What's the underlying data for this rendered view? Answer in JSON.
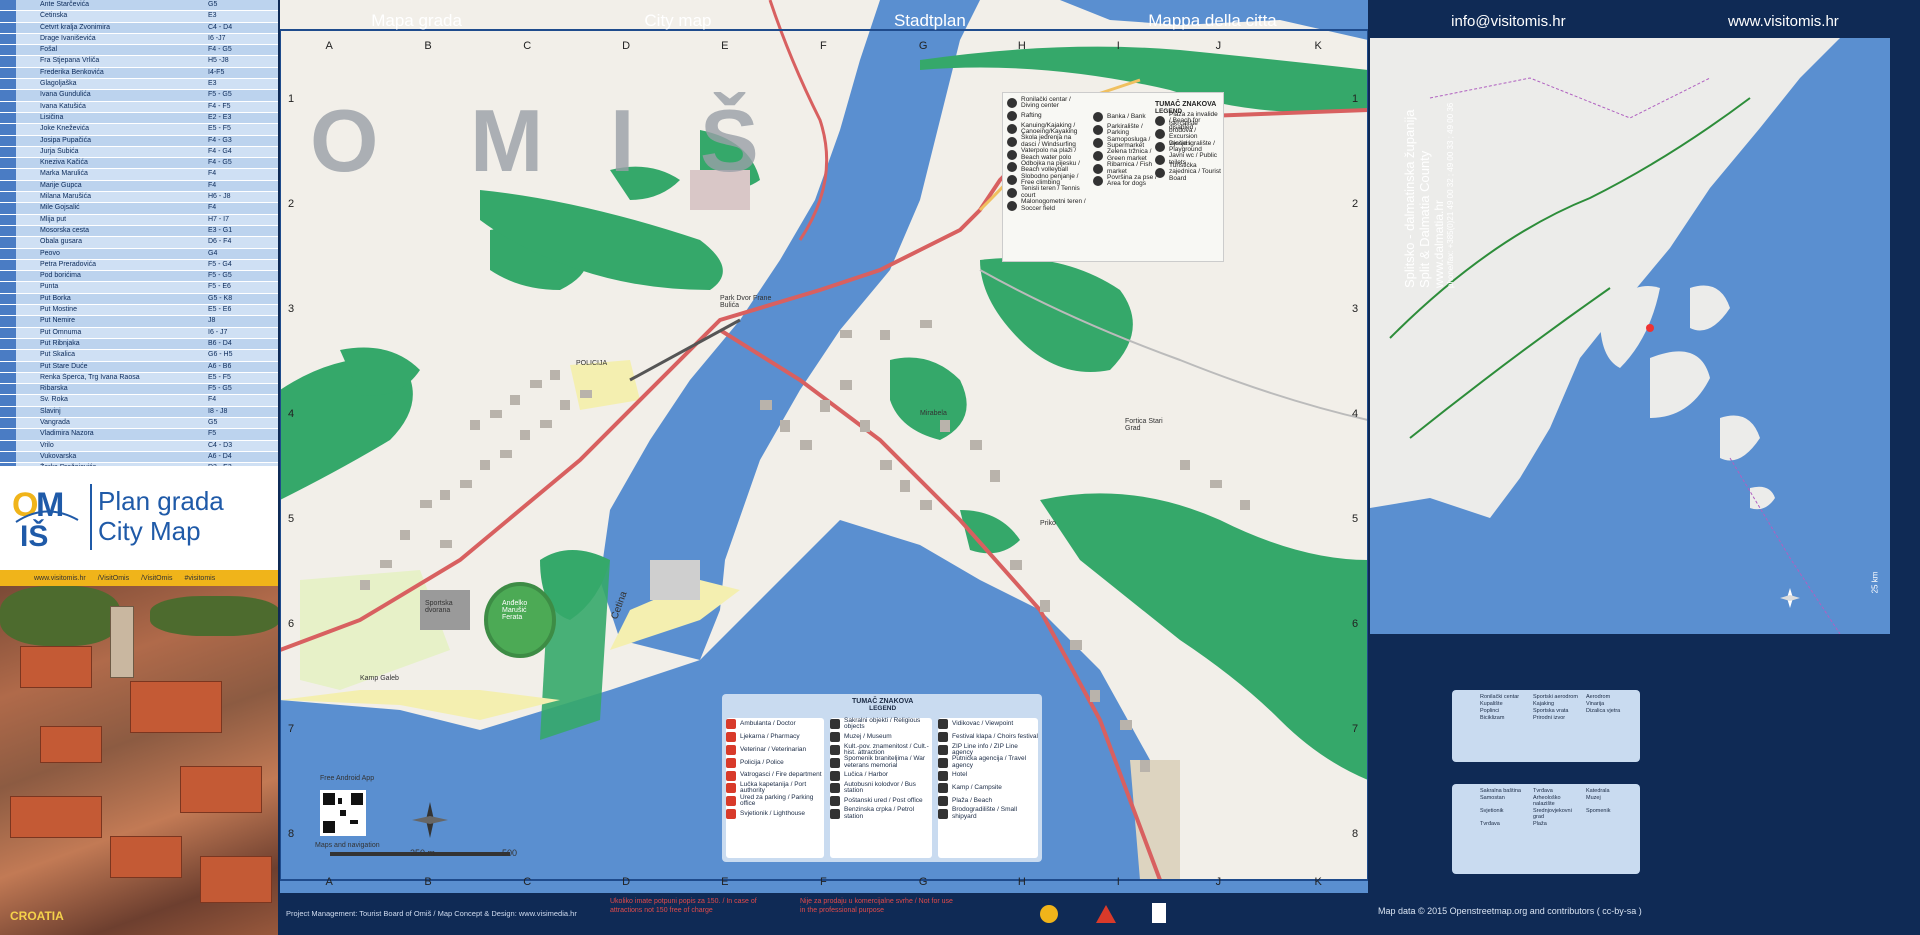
{
  "streets": [
    {
      "name": "Ante Starčevića",
      "grid": "G5"
    },
    {
      "name": "Četinska",
      "grid": "E3"
    },
    {
      "name": "Četvrt kralja Zvonimira",
      "grid": "C4 - D4"
    },
    {
      "name": "Drage Ivaniševića",
      "grid": "I6 -J7"
    },
    {
      "name": "Fošal",
      "grid": "F4 - G5"
    },
    {
      "name": "Fra Stjepana Vrliča",
      "grid": "H5 -J8"
    },
    {
      "name": "Frederika Benkovića",
      "grid": "I4-F5"
    },
    {
      "name": "Glagoljaška",
      "grid": "E3"
    },
    {
      "name": "Ivana Gundulića",
      "grid": "F5 - G5"
    },
    {
      "name": "Ivana Katušića",
      "grid": "F4 - F5"
    },
    {
      "name": "Lisičina",
      "grid": "E2 - E3"
    },
    {
      "name": "Joke Kneževića",
      "grid": "E5 - F5"
    },
    {
      "name": "Josipa Pupačića",
      "grid": "F4 - G3"
    },
    {
      "name": "Jurja Šubića",
      "grid": "F4 - G4"
    },
    {
      "name": "Kneziva Kačića",
      "grid": "F4 - G5"
    },
    {
      "name": "Marka Marulića",
      "grid": "F4"
    },
    {
      "name": "Marije Gupca",
      "grid": "F4"
    },
    {
      "name": "Milana Marušića",
      "grid": "H6 - J8"
    },
    {
      "name": "Mile Gojsalić",
      "grid": "F4"
    },
    {
      "name": "Mlija put",
      "grid": "H7 - I7"
    },
    {
      "name": "Mosorska cesta",
      "grid": "E3 - G1"
    },
    {
      "name": "Obala gusara",
      "grid": "D6 - F4"
    },
    {
      "name": "Peovo",
      "grid": "G4"
    },
    {
      "name": "Petra Preradovića",
      "grid": "F5 - G4"
    },
    {
      "name": "Pod borićima",
      "grid": "F5 - G5"
    },
    {
      "name": "Punta",
      "grid": "F5 - E6"
    },
    {
      "name": "Put Borka",
      "grid": "G5 - K8"
    },
    {
      "name": "Put Mostine",
      "grid": "E5 - E6"
    },
    {
      "name": "Put Nemire",
      "grid": "J8"
    },
    {
      "name": "Put Omnuma",
      "grid": "I6 - J7"
    },
    {
      "name": "Put Ribnjaka",
      "grid": "B6 - D4"
    },
    {
      "name": "Put Skalica",
      "grid": "G6 - H5"
    },
    {
      "name": "Put Stare Duće",
      "grid": "A6 - B6"
    },
    {
      "name": "Renka Šperca, Trg Ivana Raosa",
      "grid": "E5 - F5"
    },
    {
      "name": "Ribarska",
      "grid": "F5 - G5"
    },
    {
      "name": "Sv. Roka",
      "grid": "F4"
    },
    {
      "name": "Slavinj",
      "grid": "I8 - J8"
    },
    {
      "name": "Vangrada",
      "grid": "G5"
    },
    {
      "name": "Vladimira Nazora",
      "grid": "F5"
    },
    {
      "name": "Vrilo",
      "grid": "C4 - D3"
    },
    {
      "name": "Vukovarska",
      "grid": "A6 - D4"
    },
    {
      "name": "Žarka Dražojevića",
      "grid": "D3 - E3"
    }
  ],
  "brand": {
    "title_line1": "Plan grada",
    "title_line2": "City Map",
    "website": "www.visitomis.hr",
    "social1": "/VisitOmis",
    "social2": "/VisitOmis",
    "social3": "#visitomis",
    "photo_badge": "CROATIA"
  },
  "map": {
    "header": [
      "Mapa grada",
      "City map",
      "Stadtplan",
      "Mappa della citta"
    ],
    "columns": [
      "A",
      "B",
      "C",
      "D",
      "E",
      "F",
      "G",
      "H",
      "I",
      "J",
      "K"
    ],
    "rows": [
      "1",
      "2",
      "3",
      "4",
      "5",
      "6",
      "7",
      "8"
    ],
    "town_name": [
      "O",
      "M",
      "I",
      "Š"
    ],
    "labels": {
      "cetina": "Cetina",
      "kamp": "Kamp Galeb",
      "sportska": "Sportska dvorana",
      "stadium": "Anđelko Marušić Ferata",
      "park": "Park Dvor Frane Bulića",
      "fortica": "Fortica Stari Grad",
      "mirabela": "Mirabela",
      "priko": "Priko",
      "app": "Free Android App",
      "nav": "Maps and navigation",
      "scale_250": "250 m",
      "scale_500": "500",
      "policija": "POLICIJA"
    },
    "activity_legend": {
      "title": "TUMAČ ZNAKOVA",
      "subtitle": "LEGEND",
      "col1": [
        "Ronilački centar / Diving center",
        "Rafting",
        "Kanuing/Kajaking / Canoeing/Kayaking",
        "Škola jedrenja na dasci / Windsurfing",
        "Vaterpolo na plaži / Beach water polo",
        "Odbojka na pijesku / Beach volleyball",
        "Slobodno penjanje / Free climbing",
        "Tenisli teren / Tennis court",
        "Malonogometni teren / Soccer field"
      ],
      "col2": [
        "Banka / Bank",
        "Parkiralište / Parking",
        "Samoposluga / Supermarket",
        "Zelena tržnica / Green market",
        "Ribarnica / Fish market",
        "Površina za pse / Area for dogs"
      ],
      "col3": [
        "Plaža za invalide / Beach for disabled",
        "Iskrcalište brodova / Excursion vessels",
        "Dječje igralište / Playground",
        "Javni wc / Public toilets",
        "Turistička zajednica / Tourist Board"
      ]
    },
    "service_legend": {
      "title": "TUMAČ ZNAKOVA",
      "subtitle": "LEGEND",
      "col1": [
        "Ambulanta / Doctor",
        "Ljekarna / Pharmacy",
        "Veterinar / Veterinarian",
        "Policija / Police",
        "Vatrogasci / Fire department",
        "Lučka kapetanija / Port authority",
        "Ured za parking / Parking office",
        "Svjetionik / Lighthouse"
      ],
      "col2": [
        "Sakralni objekti / Religious objects",
        "Muzej / Museum",
        "Kult.-pov. znamenitost / Cult.-hist. attraction",
        "Spomenik braniteljima / War veterans memorial",
        "Lučica / Harbor",
        "Autobusni kolodvor / Bus station",
        "Poštanski ured / Post office",
        "Benzinska crpka / Petrol station"
      ],
      "col3": [
        "Vidikovac / Viewpoint",
        "Festival klapa / Choirs festival",
        "ZIP Line info / ZIP Line agency",
        "Putnička agencija / Travel agency",
        "Hotel",
        "Kamp / Campsite",
        "Plaža / Beach",
        "Brodogradilište / Small shipyard"
      ]
    },
    "footer": {
      "credit": "Project Management: Tourist Board of Omiš / Map Concept & Design: www.visimedia.hr",
      "note1": "Ukoliko imate potpuni popis za 150. / In case of attractions not 150 free of charge",
      "note2": "Nije za prodaju u komercijalne svrhe / Not for use in the professional purpose"
    }
  },
  "right_panel": {
    "email": "info@visitomis.hr",
    "website": "www.visitomis.hr",
    "county_hr": "Splitsko - dalmatinska županija",
    "county_en": "Split & Dalmatia County",
    "county_web": "www.dalmatia.hr",
    "phone": "phone/fax: +385(0)21 49 00 32 ; 49 00 33 ; 49 00 36",
    "scale": "25 km",
    "footer": "Map data © 2015 Openstreetmap.org and contributors ( cc-by-sa )",
    "legend_top": [
      "Ronilački centar",
      "Sportski aerodrom",
      "Aerodrom",
      "Kupalište",
      "Kajaking",
      "Vinarija",
      "Poplinci",
      "Sportska vrata",
      "Dizalica vjetra",
      "Biciklizam",
      "Prirodni izvor"
    ],
    "legend_bottom": [
      "Sakralna baština",
      "Tvrđava",
      "Katedrala",
      "Samostan",
      "Arheološko nalazište",
      "Muzej",
      "Svjetionik",
      "Srednjovjekovni grad",
      "Spomenik",
      "Tvrđava",
      "Plaža"
    ]
  },
  "colors": {
    "water": "#5a8fd0",
    "land": "#f2efe9",
    "forest": "#35a86a",
    "roads": "#d86060",
    "navy": "#0f2a55",
    "brand_blue": "#1f5aa8",
    "brand_yellow": "#f0b41a"
  }
}
